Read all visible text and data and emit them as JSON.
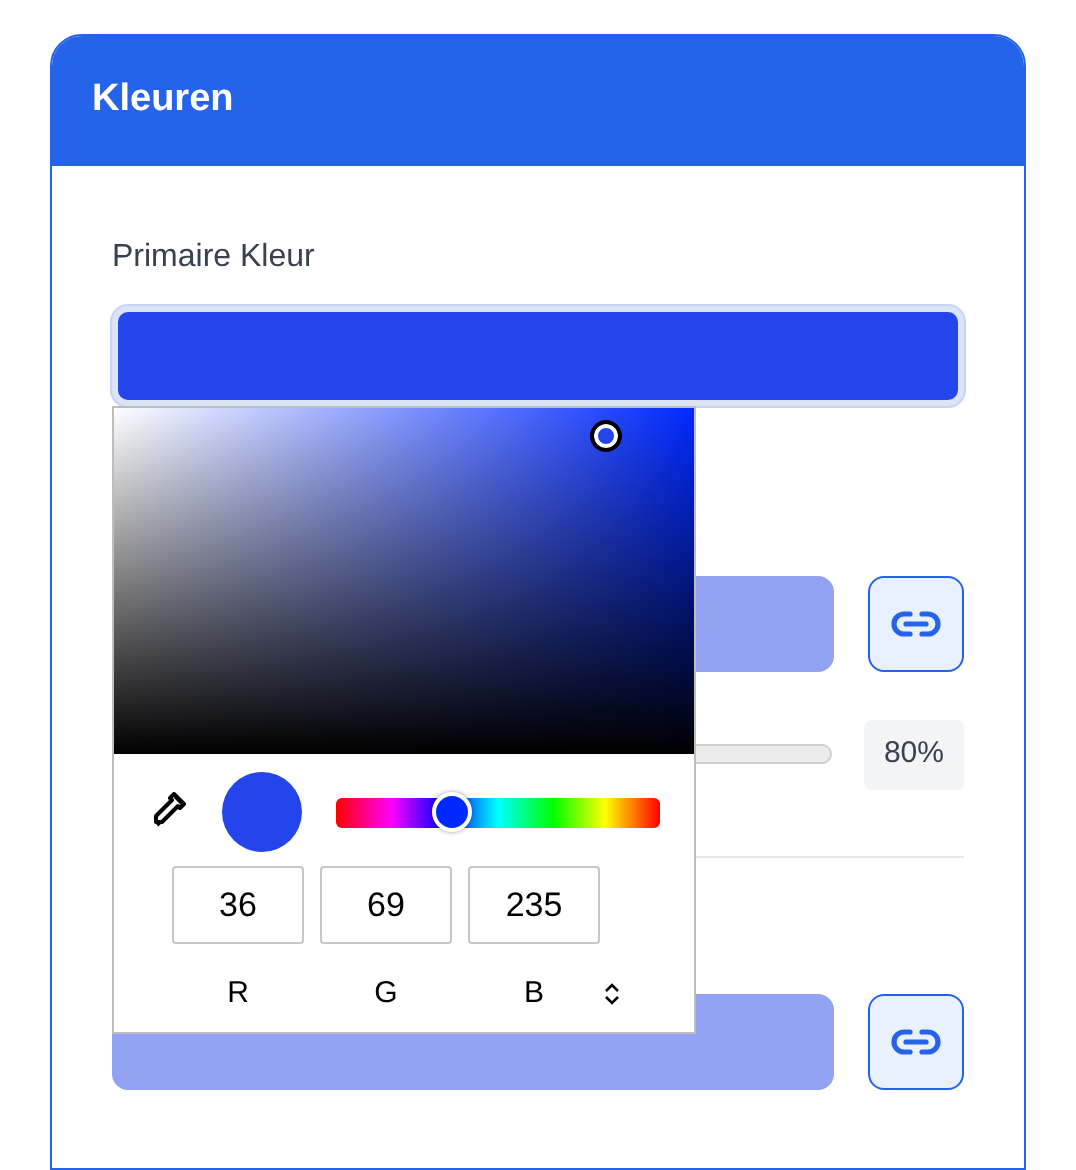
{
  "card": {
    "title": "Kleuren"
  },
  "primary": {
    "label": "Primaire Kleur",
    "color": "#2445eb"
  },
  "secondary": {
    "color": "#93a2f2"
  },
  "opacity": {
    "reading": "80%"
  },
  "tertiary": {
    "color": "#93a2f2"
  },
  "picker": {
    "hue": {
      "level": 0.36
    },
    "channels": [
      {
        "label": "R",
        "value": "36"
      },
      {
        "label": "G",
        "value": "69"
      },
      {
        "label": "B",
        "value": "235"
      }
    ]
  }
}
